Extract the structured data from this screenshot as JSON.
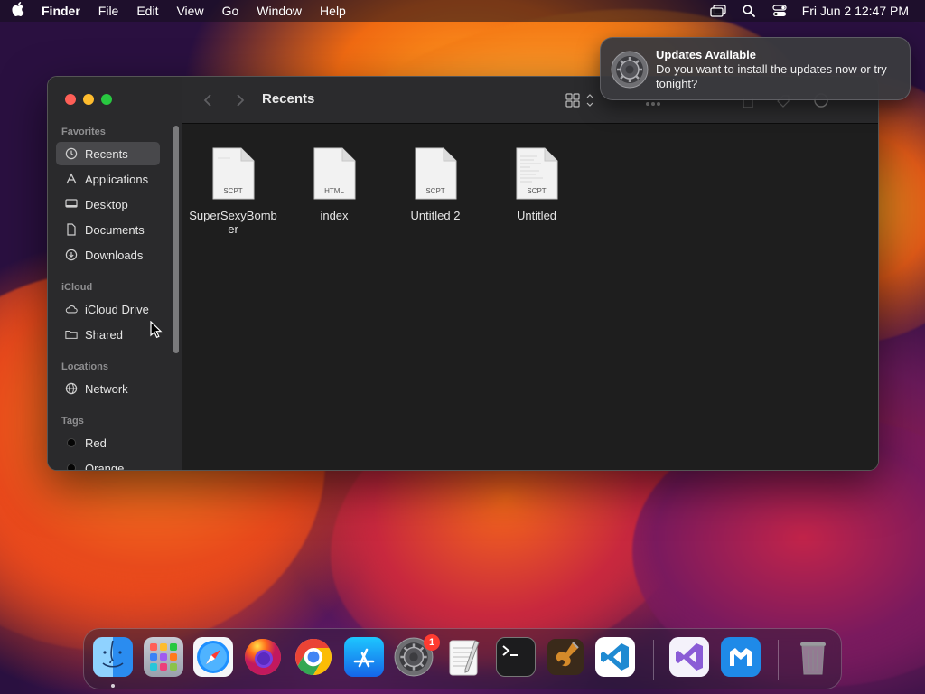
{
  "menubar": {
    "app_name": "Finder",
    "menus": [
      "File",
      "Edit",
      "View",
      "Go",
      "Window",
      "Help"
    ],
    "clock": "Fri Jun 2  12:47 PM",
    "icons": [
      "apple-icon",
      "screen-mirroring-icon",
      "search-icon",
      "control-center-icon"
    ]
  },
  "finder": {
    "title": "Recents",
    "sidebar": {
      "favorites_header": "Favorites",
      "favorites": [
        {
          "label": "Recents",
          "icon": "clock-icon",
          "selected": true
        },
        {
          "label": "Applications",
          "icon": "applications-icon"
        },
        {
          "label": "Desktop",
          "icon": "desktop-icon"
        },
        {
          "label": "Documents",
          "icon": "document-icon"
        },
        {
          "label": "Downloads",
          "icon": "download-icon"
        }
      ],
      "icloud_header": "iCloud",
      "icloud": [
        {
          "label": "iCloud Drive",
          "icon": "cloud-icon"
        },
        {
          "label": "Shared",
          "icon": "shared-folder-icon"
        }
      ],
      "locations_header": "Locations",
      "locations": [
        {
          "label": "Network",
          "icon": "globe-icon"
        }
      ],
      "tags_header": "Tags",
      "tags": [
        {
          "label": "Red",
          "color": "#000000"
        },
        {
          "label": "Orange",
          "color": "#000000"
        }
      ]
    },
    "files": [
      {
        "name": "SuperSexyBomber",
        "type": "SCPT"
      },
      {
        "name": "index",
        "type": "HTML"
      },
      {
        "name": "Untitled 2",
        "type": "SCPT"
      },
      {
        "name": "Untitled",
        "type": "SCPT"
      }
    ]
  },
  "notification": {
    "title": "Updates Available",
    "body": "Do you want to install the updates now or try tonight?",
    "icon": "system-preferences-gear-icon"
  },
  "dock": {
    "apps": [
      "Finder",
      "Launchpad",
      "Safari",
      "Firefox",
      "Chrome",
      "App Store",
      "System Preferences",
      "TextEdit",
      "Terminal",
      "GarageBand",
      "Visual Studio Code",
      "Visual Studio",
      "Maxthon",
      "Trash"
    ],
    "system_preferences_badge": "1"
  },
  "colors": {
    "accent_red": "#fe5f57",
    "accent_yellow": "#febc2e",
    "accent_green": "#28c840",
    "badge": "#ff3b30"
  }
}
